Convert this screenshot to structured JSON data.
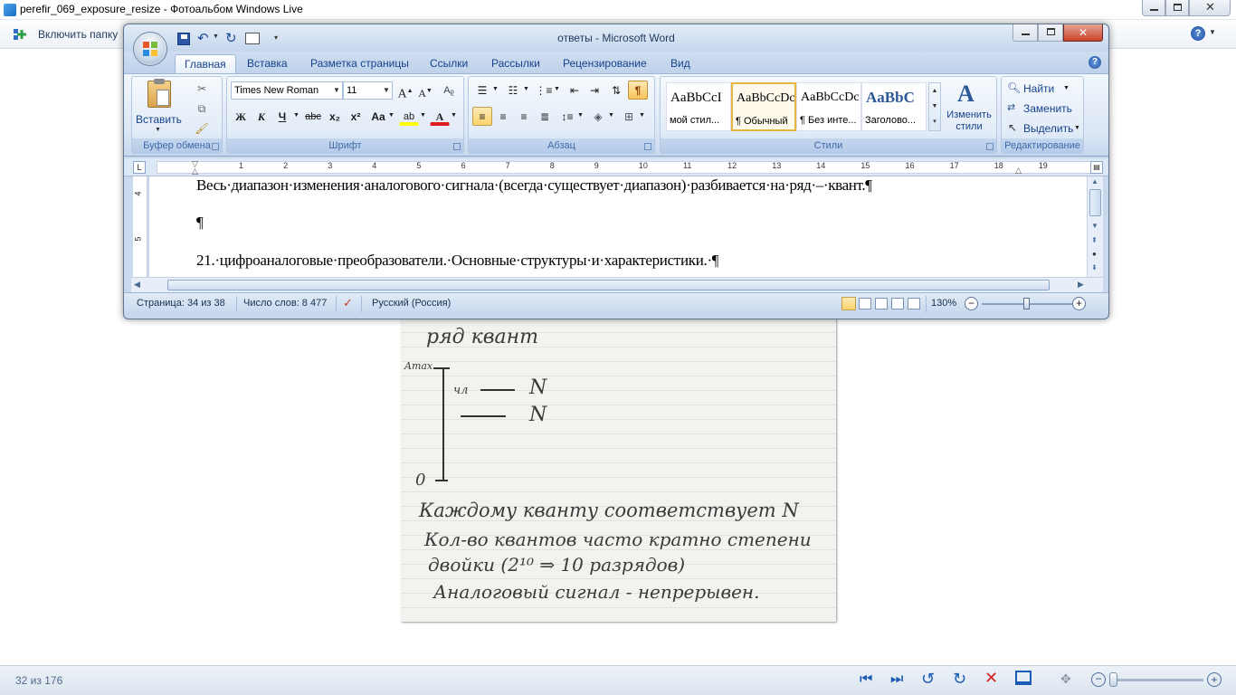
{
  "gallery": {
    "title": "perefir_069_exposure_resize - Фотоальбом Windows Live",
    "toolbar_include_folder": "Включить папку",
    "status_counter": "32 из 176"
  },
  "photo": {
    "lines": [
      "ряд квант",
      "Amax",
      "чл",
      "N",
      "N",
      "0",
      "Каждому кванту соответствует N",
      "Кол-во квантов часто кратно степени",
      "двойки (2¹⁰ ⇒ 10 разрядов)",
      "Аналоговый сигнал - непрерывен."
    ]
  },
  "word": {
    "title": "ответы - Microsoft Word",
    "tabs": [
      "Главная",
      "Вставка",
      "Разметка страницы",
      "Ссылки",
      "Рассылки",
      "Рецензирование",
      "Вид"
    ],
    "ribbon": {
      "clipboard": {
        "paste_label": "Вставить",
        "group_label": "Буфер обмена"
      },
      "font": {
        "name": "Times New Roman",
        "size": "11",
        "group_label": "Шрифт",
        "bold": "Ж",
        "italic": "К",
        "underline": "Ч",
        "strike": "abc",
        "sub": "x₂",
        "sup": "x²",
        "case": "Aa"
      },
      "paragraph": {
        "group_label": "Абзац"
      },
      "styles": {
        "group_label": "Стили",
        "items": [
          {
            "sample": "AaBbCcI",
            "name": "мой стил..."
          },
          {
            "sample": "AaBbCcDc",
            "name": "¶ Обычный"
          },
          {
            "sample": "AaBbCcDc",
            "name": "¶ Без инте..."
          },
          {
            "sample": "AaBbC",
            "name": "Заголово..."
          }
        ],
        "change_styles": "Изменить стили"
      },
      "editing": {
        "group_label": "Редактирование",
        "find": "Найти",
        "replace": "Заменить",
        "select": "Выделить"
      }
    },
    "ruler_numbers": [
      "1",
      "2",
      "3",
      "4",
      "5",
      "6",
      "7",
      "8",
      "9",
      "10",
      "11",
      "12",
      "13",
      "14",
      "15",
      "16",
      "17",
      "18",
      "19"
    ],
    "vruler_numbers": [
      "4",
      "5"
    ],
    "document": {
      "line1": "Весь·диапазон·изменения·аналогового·сигнала·(всегда·существует·диапазон)·разбивается·на·ряд·–·квант.¶",
      "line2": "¶",
      "line3": "21.·цифроаналоговые·преобразователи.·Основные·структуры·и·характеристики.·¶"
    },
    "status": {
      "page": "Страница: 34 из 38",
      "words": "Число слов: 8 477",
      "language": "Русский (Россия)",
      "zoom": "130%"
    }
  },
  "colors": {
    "accent": "#15428b",
    "ribbon": "#dce7f5",
    "highlight": "#fbd36b"
  }
}
